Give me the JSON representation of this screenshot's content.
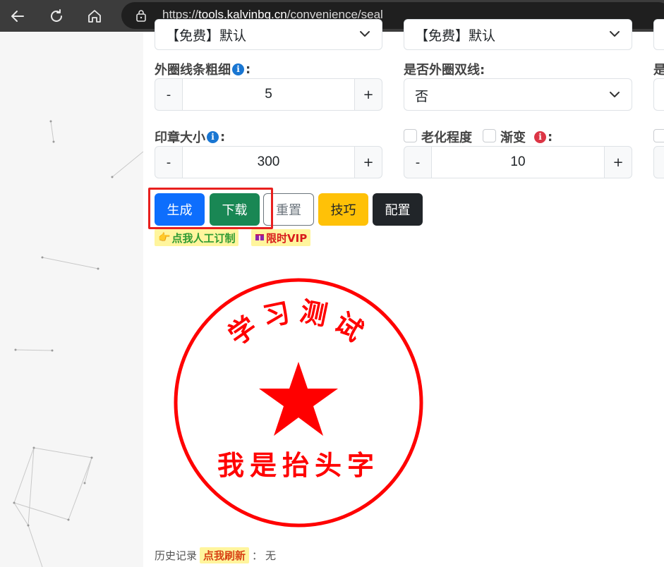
{
  "browser": {
    "url_prefix": "https://",
    "url_host": "tools.kalvinbg.cn",
    "url_path": "/convenience/seal"
  },
  "form": {
    "top_select_left": "【免费】默认",
    "top_select_mid": "【免费】默认",
    "outer_line_label": "外圈线条粗细",
    "outer_line_value": "5",
    "double_line_label": "是否外圈双线:",
    "double_line_value": "否",
    "third_col_label_partial": "是",
    "seal_size_label": "印章大小",
    "seal_size_value": "300",
    "aging_label": "老化程度",
    "gradient_label": "渐变",
    "aging_value": "10",
    "colon": ":",
    "minus": "-",
    "plus": "+"
  },
  "buttons": {
    "generate": "生成",
    "download": "下载",
    "reset": "重置",
    "tips": "技巧",
    "config": "配置"
  },
  "tags": {
    "custom": "点我人工订制",
    "vip": "限时VIP"
  },
  "seal": {
    "top_text": "学习测试",
    "bottom_text": "我是抬头字",
    "color": "#ff0000"
  },
  "history": {
    "label": "历史记录",
    "refresh": "点我刷新",
    "sep": "：",
    "value": "无"
  },
  "colors": {
    "primary": "#0d6efd",
    "success": "#198754",
    "warning": "#ffc107",
    "dark": "#212529",
    "highlight": "#e8201e"
  }
}
